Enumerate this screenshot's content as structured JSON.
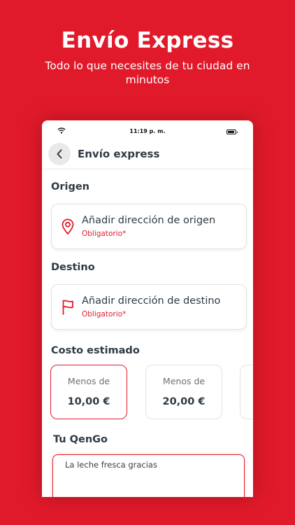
{
  "promo": {
    "title": "Envío Express",
    "subtitle": "Todo lo que necesites de tu ciudad en minutos"
  },
  "status_bar": {
    "time": "11:19 p. m."
  },
  "header": {
    "title": "Envío express"
  },
  "origin": {
    "section_label": "Origen",
    "placeholder": "Añadir dirección de origen",
    "required_text": "Obligatorio*"
  },
  "destination": {
    "section_label": "Destino",
    "placeholder": "Añadir dirección de destino",
    "required_text": "Obligatorio*"
  },
  "cost": {
    "section_label": "Costo estimado",
    "options": [
      {
        "prefix": "Menos de",
        "value": "10,00 €",
        "selected": true
      },
      {
        "prefix": "Menos de",
        "value": "20,00 €",
        "selected": false
      }
    ]
  },
  "note": {
    "section_label": "Tu QenGo",
    "value": "La leche fresca gracias"
  },
  "colors": {
    "brand": "#e11a2b",
    "text": "#2f3a44"
  },
  "icons": [
    "wifi-icon",
    "battery-icon",
    "chevron-left-icon",
    "location-pin-icon",
    "flag-icon"
  ]
}
